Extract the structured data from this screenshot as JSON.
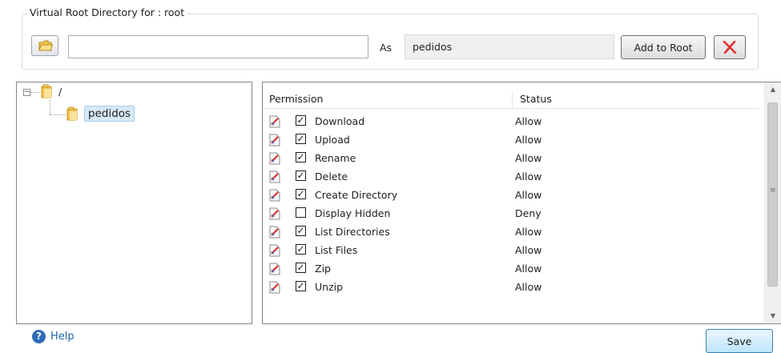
{
  "group": {
    "title": "Virtual Root Directory for : root"
  },
  "toolbar": {
    "path_value": "",
    "as_label": "As",
    "alias_value": "pedidos",
    "add_to_root_label": "Add to Root",
    "folder_button_icon": "folder-open-icon",
    "delete_button_icon": "red-x-icon"
  },
  "tree": {
    "root_label": "/",
    "child_label": "pedidos"
  },
  "grid": {
    "headers": {
      "permission": "Permission",
      "status": "Status"
    },
    "rows": [
      {
        "name": "Download",
        "checked": true,
        "status": "Allow"
      },
      {
        "name": "Upload",
        "checked": true,
        "status": "Allow"
      },
      {
        "name": "Rename",
        "checked": true,
        "status": "Allow"
      },
      {
        "name": "Delete",
        "checked": true,
        "status": "Allow"
      },
      {
        "name": "Create Directory",
        "checked": true,
        "status": "Allow"
      },
      {
        "name": "Display Hidden",
        "checked": false,
        "status": "Deny"
      },
      {
        "name": "List Directories",
        "checked": true,
        "status": "Allow"
      },
      {
        "name": "List Files",
        "checked": true,
        "status": "Allow"
      },
      {
        "name": "Zip",
        "checked": true,
        "status": "Allow"
      },
      {
        "name": "Unzip",
        "checked": true,
        "status": "Allow"
      }
    ]
  },
  "footer": {
    "help_label": "Help",
    "save_label": "Save"
  },
  "colors": {
    "accent": "#2f6cb6",
    "selection": "#d6e9f7",
    "delete_red": "#e03030"
  }
}
